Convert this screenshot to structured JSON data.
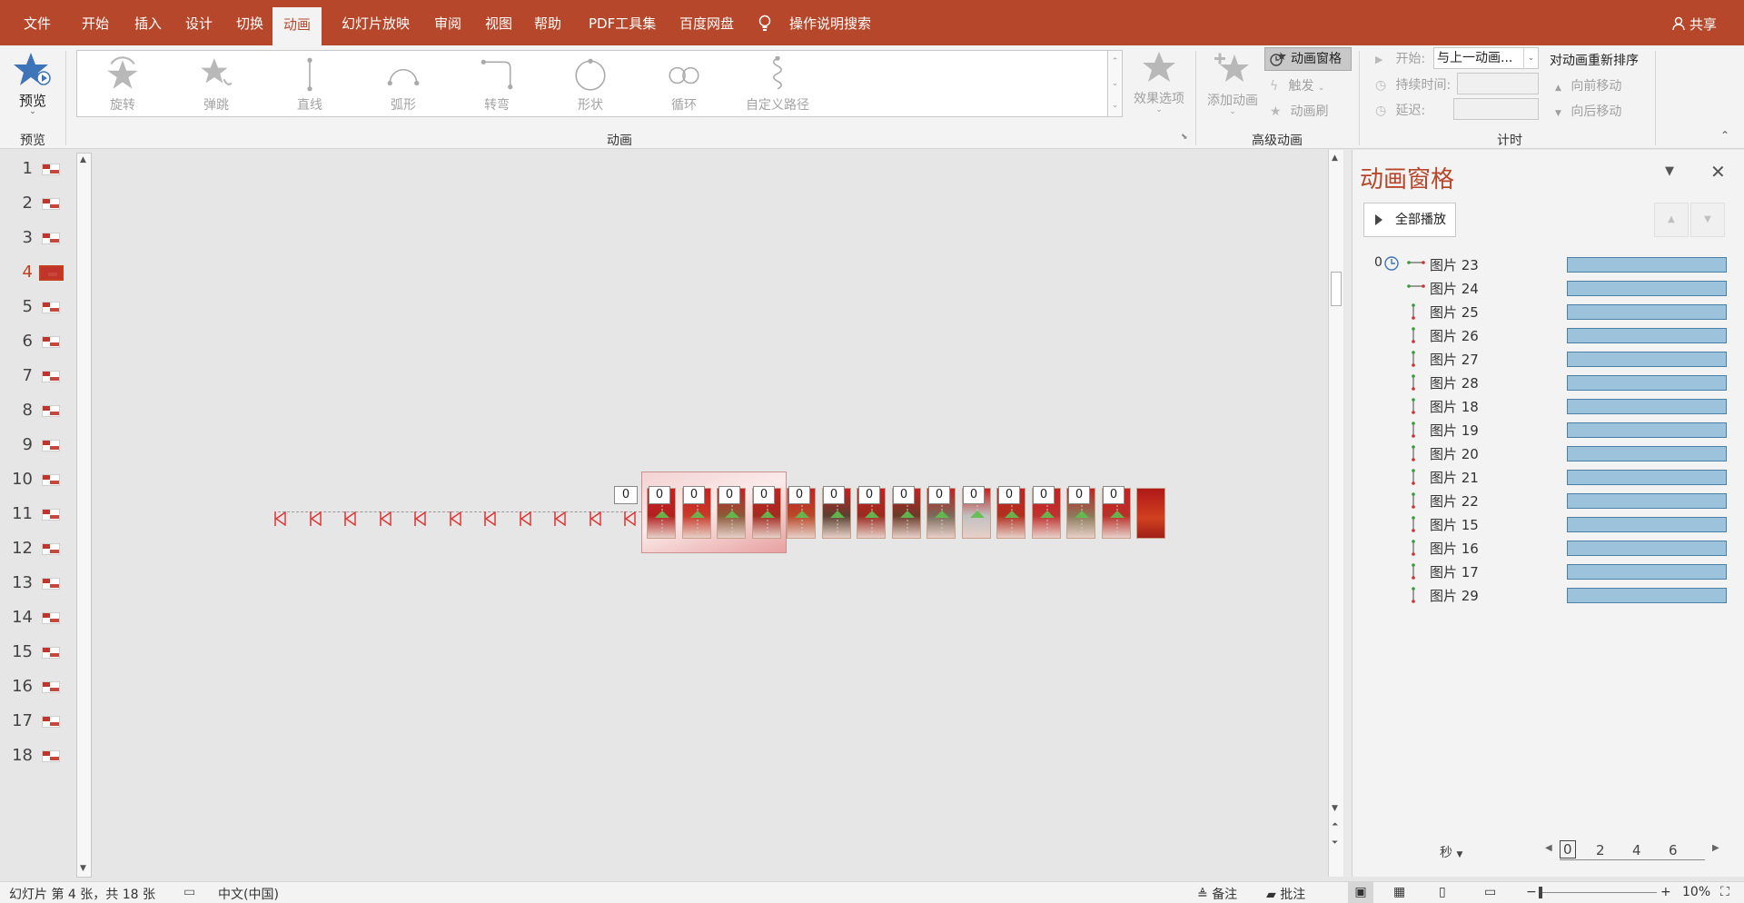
{
  "ribbon_tabs": [
    "文件",
    "开始",
    "插入",
    "设计",
    "切换",
    "动画",
    "幻灯片放映",
    "审阅",
    "视图",
    "帮助",
    "PDF工具集",
    "百度网盘"
  ],
  "active_tab": "动画",
  "tell_me": "操作说明搜索",
  "share": "共享",
  "preview": {
    "label": "预览",
    "group": "预览"
  },
  "effects": [
    "旋转",
    "弹跳",
    "直线",
    "弧形",
    "转弯",
    "形状",
    "循环",
    "自定义路径"
  ],
  "effect_options": "效果选项",
  "group_animation": "动画",
  "advanced": {
    "group": "高级动画",
    "add_animation": "添加动画",
    "animation_pane": "动画窗格",
    "trigger": "触发",
    "painter": "动画刷"
  },
  "timing": {
    "group": "计时",
    "start_label": "开始:",
    "start_value": "与上一动画...",
    "duration_label": "持续时间:",
    "delay_label": "延迟:",
    "reorder": "对动画重新排序",
    "move_earlier": "向前移动",
    "move_later": "向后移动"
  },
  "slides": [
    "1",
    "2",
    "3",
    "4",
    "5",
    "6",
    "7",
    "8",
    "9",
    "10",
    "11",
    "12",
    "13",
    "14",
    "15",
    "16",
    "17",
    "18"
  ],
  "active_slide": 4,
  "canvas": {
    "badges": [
      "0",
      "0",
      "0",
      "0",
      "0",
      "0",
      "0",
      "0",
      "0",
      "0",
      "0",
      "0",
      "0",
      "0",
      "0"
    ]
  },
  "pane": {
    "title": "动画窗格",
    "play_all": "全部播放",
    "first_order": "0",
    "items": [
      "图片 23",
      "图片 24",
      "图片 25",
      "图片 26",
      "图片 27",
      "图片 28",
      "图片 18",
      "图片 19",
      "图片 20",
      "图片 21",
      "图片 22",
      "图片 15",
      "图片 16",
      "图片 17",
      "图片 29"
    ],
    "item_types": [
      "horizontal",
      "horizontal",
      "vertical",
      "vertical",
      "vertical",
      "vertical",
      "vertical",
      "vertical",
      "vertical",
      "vertical",
      "vertical",
      "vertical",
      "vertical",
      "vertical",
      "vertical"
    ],
    "seconds": "秒",
    "timeline": [
      "0",
      "2",
      "4",
      "6"
    ]
  },
  "status": {
    "slide_info": "幻灯片 第 4 张，共 18 张",
    "language": "中文(中国)",
    "notes": "备注",
    "comments": "批注",
    "zoom": "10%"
  },
  "colors": {
    "accent": "#b7472a",
    "bar": "#9dc3dc"
  }
}
